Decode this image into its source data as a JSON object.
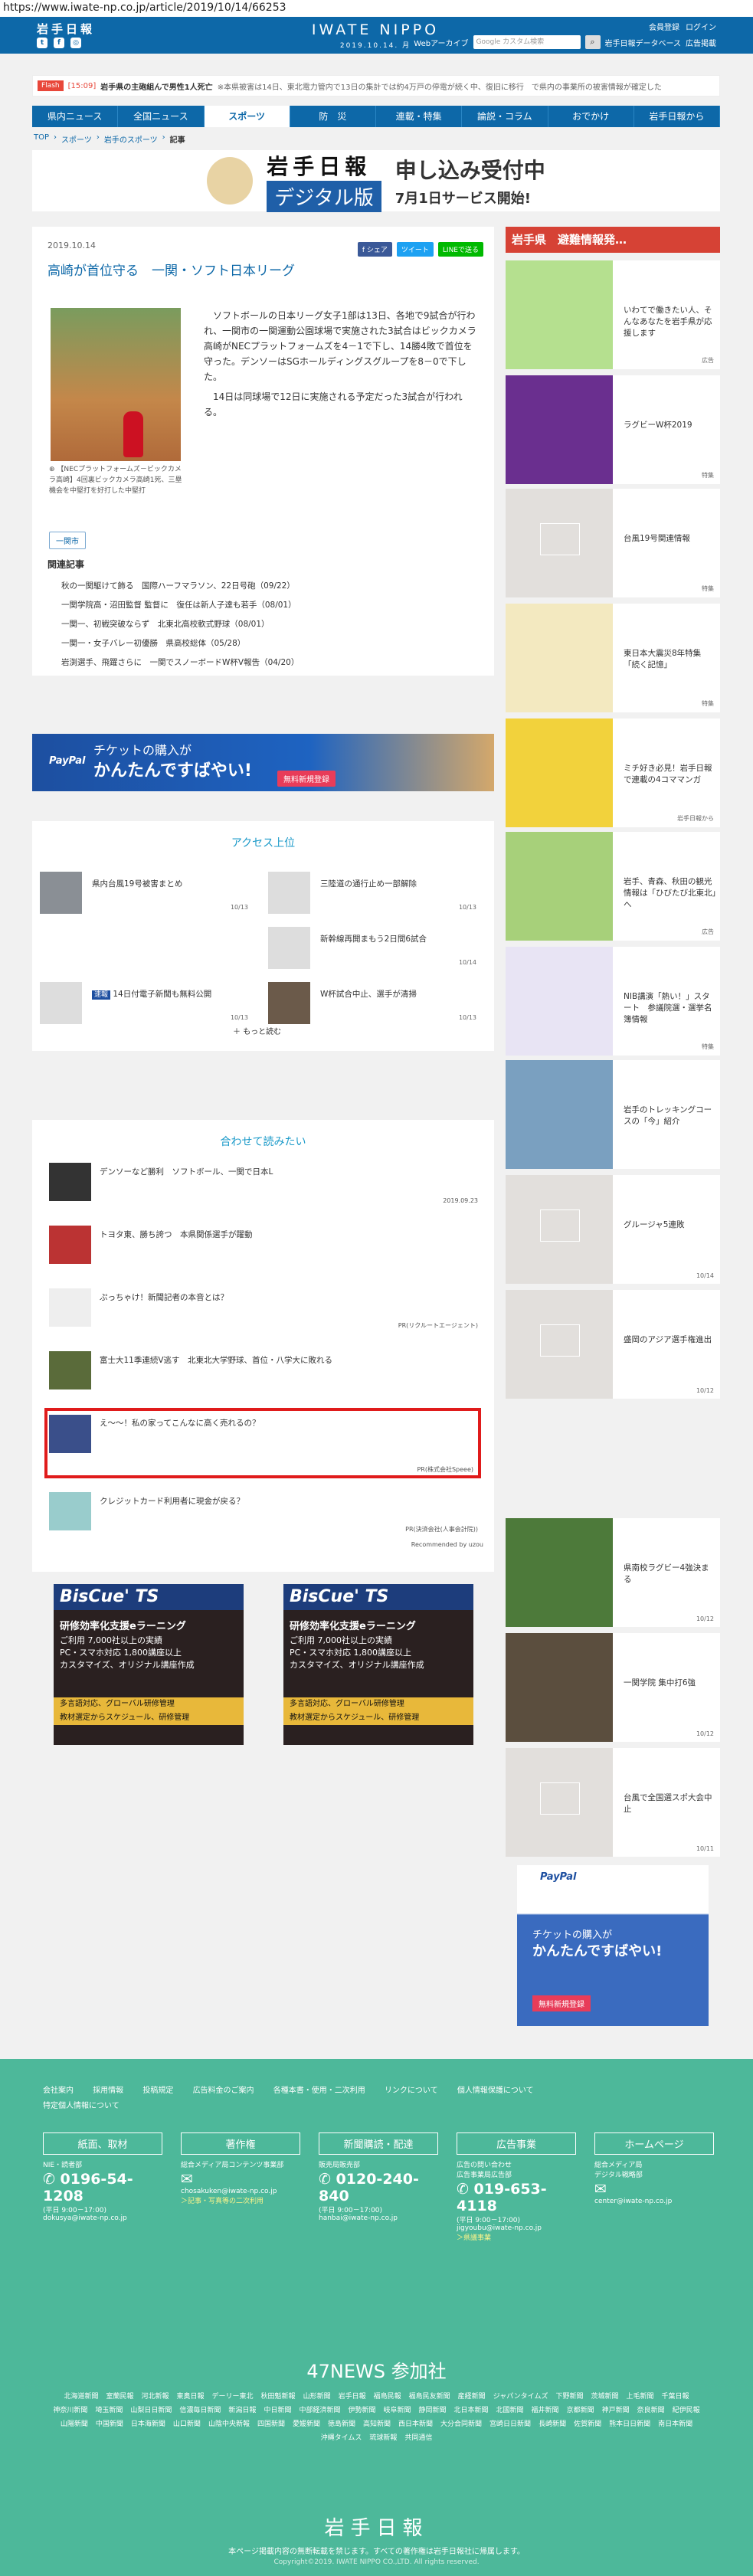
{
  "url": "https://www.iwate-np.co.jp/article/2019/10/14/66253",
  "header": {
    "logo": "岩手日報",
    "brand": "IWATE NIPPO",
    "date": "2019.10.14. 月",
    "links": [
      "会員登録",
      "ログイン"
    ],
    "sublinks": [
      "Webアーカイブ",
      "岩手日報データベース",
      "広告掲載"
    ],
    "search_placeholder": "Google カスタム検索"
  },
  "flash": {
    "tag": "Flash",
    "time": "[15:09]",
    "headline": "岩手県の主砲組んで男性1人死亡",
    "rest": "※本県被害は14日、東北電力管内で13日の集計では約4万戸の停電が続く中、復旧に移行　で県内の事業所の被害情報が確定した"
  },
  "nav": [
    "県内ニュース",
    "全国ニュース",
    "スポーツ",
    "防　災",
    "連載・特集",
    "論説・コラム",
    "おでかけ",
    "岩手日報から"
  ],
  "breadcrumb": [
    "TOP",
    "スポーツ",
    "岩手のスポーツ",
    "記事"
  ],
  "banner": {
    "logo": "岩手日報",
    "digital": "デジタル版",
    "title": "申し込み受付中",
    "sub": "7月1日サービス開始!"
  },
  "article": {
    "date": "2019.10.14",
    "share": [
      "f シェア",
      "ツイート",
      "LINEで送る"
    ],
    "title": "高崎が首位守る　一関・ソフト日本リーグ",
    "caption": "【NECプラットフォームズ－ビックカメラ高崎】4回裏ビックカメラ高崎1死、三塁機会を中堅打を好打した中堅打",
    "body": [
      "ソフトボールの日本リーグ女子1部は13日、各地で9試合が行われ、一関市の一関運動公園球場で実施された3試合はビックカメラ高崎がNECプラットフォームズを4－1で下し、14勝4敗で首位を守った。デンソーはSGホールディングスグループを8－0で下した。",
      "14日は同球場で12日に実施される予定だった3試合が行われる。"
    ],
    "tag": "一関市",
    "related_title": "関連記事",
    "related": [
      "秋の一関駆けて飾る　国際ハーフマラソン、22日号砲（09/22）",
      "一関学院高・沼田監督 監督に　復任は新人子達も若手（08/01）",
      "一関一、初戦突破ならず　北東北高校軟式野球（08/01）",
      "一関一・女子バレー初優勝　県高校総体（05/28）",
      "岩渕選手、飛躍さらに　一関でスノーボードW杯V報告（04/20）"
    ]
  },
  "paypal": {
    "logo": "PayPal",
    "t1": "チケットの購入が",
    "t2": "かんたんですばやい!",
    "btn": "無料新規登録"
  },
  "ranking": {
    "title": "アクセス上位",
    "items": [
      {
        "t": "県内台風19号被害まとめ",
        "d": "10/13"
      },
      {
        "t": "三陸道の通行止め一部解除",
        "d": "10/13"
      },
      {
        "t": "新幹線再開まもう2日間6試合",
        "d": "10/14"
      },
      {
        "t": "14日付電子新聞も無料公開",
        "d": "10/13",
        "badge": "速報"
      },
      {
        "t": "W杯試合中止、選手が清掃",
        "d": "10/13"
      }
    ],
    "more": "もっと読む"
  },
  "reco": {
    "title": "合わせて読みたい",
    "items": [
      {
        "t": "デンソーなど勝利　ソフトボール、一関で日本L",
        "s": "2019.09.23"
      },
      {
        "t": "トヨタ東、勝ち誇つ　本県関係選手が躍動",
        "s": ""
      },
      {
        "t": "ぷっちゃけ！新聞記者の本音とは？",
        "s": "PR(リクルートエージェント)"
      },
      {
        "t": "富士大11季連続V逃す　北東北大学野球、首位・八学大に敗れる",
        "s": ""
      },
      {
        "t": "え〜〜！私の家ってこんなに高く売れるの？",
        "s": "PR(株式会社Speee)"
      },
      {
        "t": "クレジットカード利用者に現金が戻る？",
        "s": "PR(決済会社(人事会計院))"
      }
    ],
    "powered": "Recommended by uzou"
  },
  "ads": [
    {
      "h": "BisCue' TS",
      "l1": "研修効率化支援eラーニング",
      "l2": "ご利用 7,000社以上の実績\nPC・スマホ対応 1,800講座以上\nカスタマイズ、オリジナル講座作成",
      "bar": "多言語対応、グローバル研修管理\n教材選定からスケジュール、研修管理"
    },
    {
      "h": "BisCue' TS",
      "l1": "研修効率化支援eラーニング",
      "l2": "ご利用 7,000社以上の実績\nPC・スマホ対応 1,800講座以上\nカスタマイズ、オリジナル講座作成",
      "bar": "多言語対応、グローバル研修管理\n教材選定からスケジュール、研修管理"
    }
  ],
  "side": {
    "evac": "岩手県　避難情報発…",
    "items": [
      {
        "t": "いわてで働きたい人、そんなあなたを岩手県が応援します",
        "g": "広告"
      },
      {
        "t": "ラグビーW杯2019",
        "g": "特集"
      },
      {
        "t": "台風19号関連情報",
        "g": "特集"
      },
      {
        "t": "東日本大震災8年特集「続く記憶」",
        "g": "特集"
      },
      {
        "t": "ミチ好き必見！岩手日報で連載の4コママンガ",
        "g": "岩手日報から"
      },
      {
        "t": "岩手、青森、秋田の観光情報は「ひびたび北東北」へ",
        "g": "広告"
      },
      {
        "t": "NIB講演「熱い！」スタート　参議院選・選挙名簿情報",
        "g": "特集"
      },
      {
        "t": "岩手のトレッキングコースの「今」紹介",
        "g": ""
      },
      {
        "t": "グルージャ5連敗",
        "d": "10/14"
      },
      {
        "t": "盛岡のアジア選手権進出",
        "d": "10/12"
      },
      {
        "t": "県南校ラグビー4強決まる",
        "d": "10/12"
      },
      {
        "t": "一関学院 集中打6強",
        "d": "10/12"
      },
      {
        "t": "台風で全国選スポ大会中止",
        "d": "10/11"
      }
    ]
  },
  "footer": {
    "links": [
      "会社案内",
      "採用情報",
      "投稿規定",
      "広告料金のご案内",
      "各種本書・使用・二次利用",
      "リンクについて",
      "個人情報保護について",
      "特定個人情報について"
    ],
    "cols": [
      {
        "h": "紙面、取材",
        "sm": "NIE・読者部",
        "tel": "0196-54-1208",
        "hours": "(平日 9:00－17:00)",
        "mail": "dokusya@iwate-np.co.jp"
      },
      {
        "h": "著作権",
        "sm": "総合メディア局コンテンツ事業部",
        "tel": "",
        "hours": "",
        "mail": "chosakuken@iwate-np.co.jp",
        "link": "＞記事・写真等の二次利用"
      },
      {
        "h": "新聞購読・配達",
        "sm": "販売局販売部",
        "tel": "0120-240-840",
        "hours": "(平日 9:00－17:00)",
        "mail": "hanbai@iwate-np.co.jp"
      },
      {
        "h": "広告事業",
        "sm": "広告の問い合わせ\n広告事業局広告部",
        "tel": "019-653-4118",
        "hours": "(平日 9:00－17:00)",
        "mail": "jigyoubu@iwate-np.co.jp",
        "link": "＞県議事業"
      },
      {
        "h": "ホームページ",
        "sm": "総合メディア局\nデジタル戦略部",
        "tel": "",
        "hours": "",
        "mail": "center@iwate-np.co.jp"
      }
    ],
    "n47title": "47NEWS 参加社",
    "n47": [
      "北海道新聞",
      "室蘭民報",
      "河北新報",
      "東奥日報",
      "デーリー東北",
      "秋田魁新報",
      "山形新聞",
      "岩手日報",
      "福島民報",
      "福島民友新聞",
      "産経新聞",
      "ジャパンタイムズ",
      "下野新聞",
      "茨城新聞",
      "上毛新聞",
      "千葉日報",
      "神奈川新聞",
      "埼玉新聞",
      "山梨日日新聞",
      "信濃毎日新聞",
      "新潟日報",
      "中日新聞",
      "中部経済新聞",
      "伊勢新聞",
      "岐阜新聞",
      "静岡新聞",
      "北日本新聞",
      "北國新聞",
      "福井新聞",
      "京都新聞",
      "神戸新聞",
      "奈良新聞",
      "紀伊民報",
      "山陽新聞",
      "中国新聞",
      "日本海新聞",
      "山口新聞",
      "山陰中央新報",
      "四国新聞",
      "愛媛新聞",
      "徳島新聞",
      "高知新聞",
      "西日本新聞",
      "大分合同新聞",
      "宮崎日日新聞",
      "長崎新聞",
      "佐賀新聞",
      "熊本日日新聞",
      "南日本新聞",
      "沖縄タイムス",
      "琉球新報",
      "共同通信"
    ],
    "logo": "岩手日報",
    "note": "本ページ掲載内容の無断転載を禁じます。すべての著作権は岩手日報社に帰属します。",
    "copy": "Copyright©2019. IWATE NIPPO CO.,LTD. All rights reserved."
  },
  "colors": {
    "brand": "#0d68a8",
    "accent": "#d64235",
    "footer": "#4db89a",
    "highlight": "#e01b1b"
  }
}
